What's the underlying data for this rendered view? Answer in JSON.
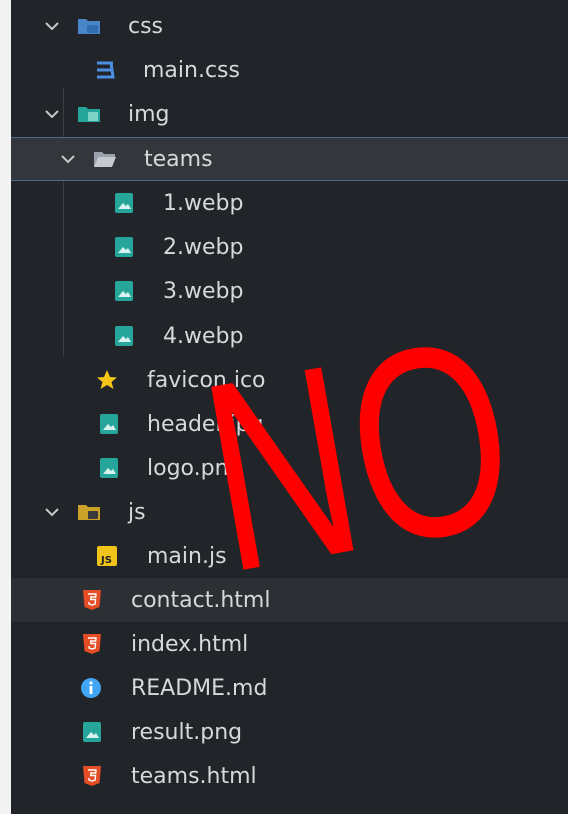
{
  "tree": [
    {
      "label": "css",
      "type": "folder-css",
      "expanded": true
    },
    {
      "label": "main.css",
      "type": "css"
    },
    {
      "label": "img",
      "type": "folder-img",
      "expanded": true
    },
    {
      "label": "teams",
      "type": "folder",
      "expanded": true,
      "state": "selected"
    },
    {
      "label": "1.webp",
      "type": "image"
    },
    {
      "label": "2.webp",
      "type": "image"
    },
    {
      "label": "3.webp",
      "type": "image"
    },
    {
      "label": "4.webp",
      "type": "image"
    },
    {
      "label": "favicon.ico",
      "type": "favicon"
    },
    {
      "label": "header.jpg",
      "type": "image"
    },
    {
      "label": "logo.png",
      "type": "image"
    },
    {
      "label": "js",
      "type": "folder-js",
      "expanded": true
    },
    {
      "label": "main.js",
      "type": "js"
    },
    {
      "label": "contact.html",
      "type": "html",
      "state": "hovered"
    },
    {
      "label": "index.html",
      "type": "html"
    },
    {
      "label": "README.md",
      "type": "info"
    },
    {
      "label": "result.png",
      "type": "image"
    },
    {
      "label": "teams.html",
      "type": "html"
    }
  ],
  "overlay": {
    "text": "NO",
    "color": "#ff0000"
  },
  "colors": {
    "background": "#212428",
    "text": "#d6d8db",
    "selected": "#33363b",
    "css": "#4a90e2",
    "html": "#e44d26",
    "image": "#26a69a",
    "js": "#f0c419",
    "star": "#f5c518",
    "info": "#42a5f5"
  }
}
